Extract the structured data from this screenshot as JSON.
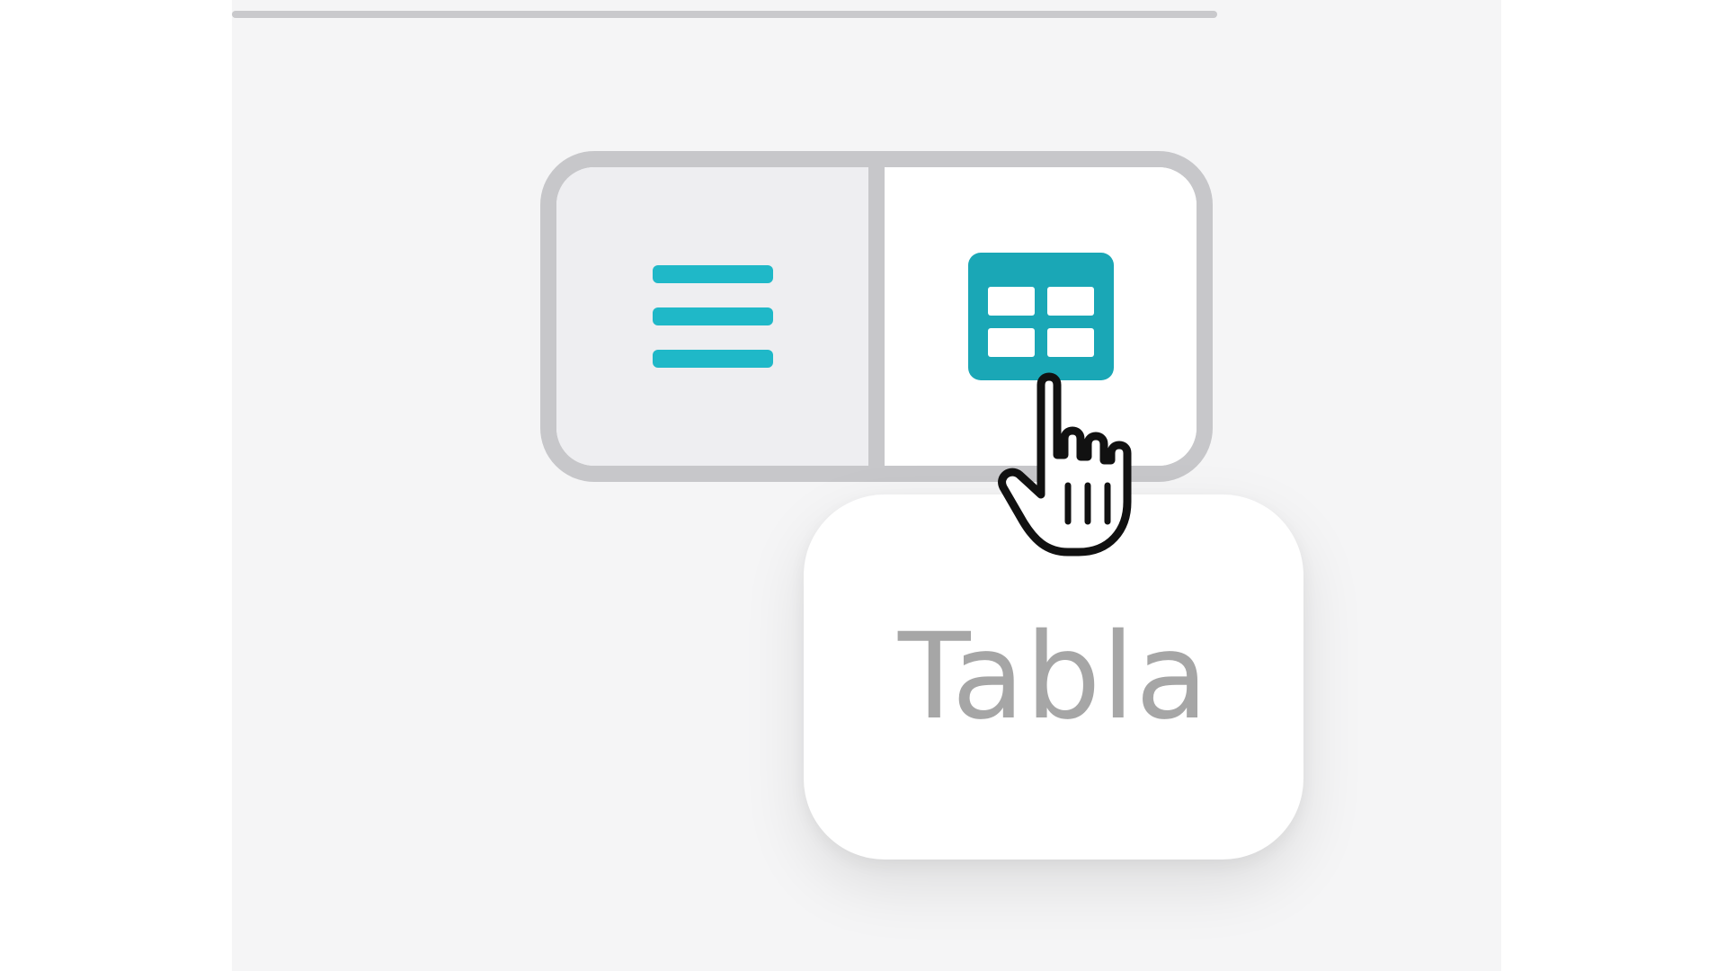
{
  "colors": {
    "accent": "#1fb8c8",
    "accent_dark": "#1a9fad",
    "border": "#c7c7ca",
    "background": "#f5f5f6",
    "tooltip_text": "#a6a6a6"
  },
  "view_toggle": {
    "buttons": [
      {
        "id": "list",
        "icon": "list-icon",
        "selected": false
      },
      {
        "id": "table",
        "icon": "table-grid-icon",
        "selected": true,
        "hovered": true
      }
    ]
  },
  "tooltip": {
    "text": "Tabla"
  },
  "cursor": {
    "icon": "hand-pointer-cursor"
  }
}
